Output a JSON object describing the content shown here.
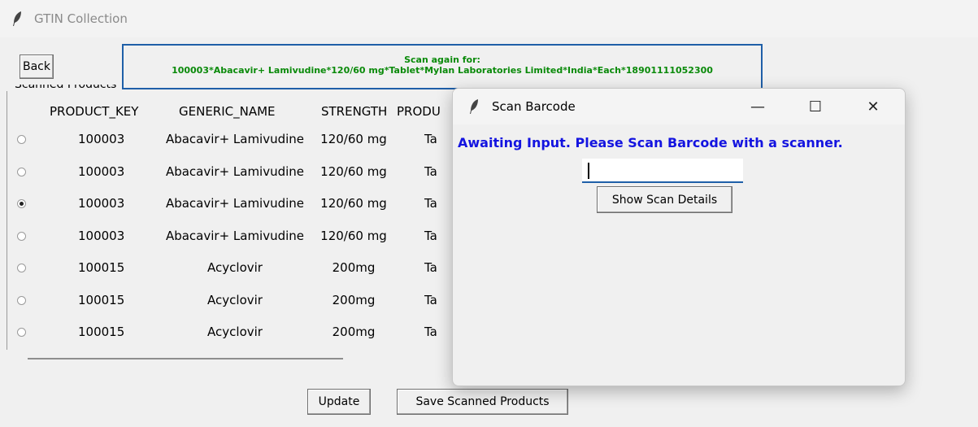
{
  "main_window": {
    "title": "GTIN Collection",
    "back_label": "Back",
    "frame_label": "Scanned Products",
    "scan_again": {
      "title": "Scan again for:",
      "detail": "100003*Abacavir+ Lamivudine*120/60 mg*Tablet*Mylan Laboratories Limited*India*Each*18901111052300"
    },
    "table": {
      "headers": [
        "PRODUCT_KEY",
        "GENERIC_NAME",
        "STRENGTH",
        "PRODU"
      ],
      "rows": [
        {
          "key": "100003",
          "name": "Abacavir+ Lamivudine",
          "strength": "120/60 mg",
          "type": "Ta",
          "selected": false
        },
        {
          "key": "100003",
          "name": "Abacavir+ Lamivudine",
          "strength": "120/60 mg",
          "type": "Ta",
          "selected": false
        },
        {
          "key": "100003",
          "name": "Abacavir+ Lamivudine",
          "strength": "120/60 mg",
          "type": "Ta",
          "selected": true
        },
        {
          "key": "100003",
          "name": "Abacavir+ Lamivudine",
          "strength": "120/60 mg",
          "type": "Ta",
          "selected": false
        },
        {
          "key": "100015",
          "name": "Acyclovir",
          "strength": "200mg",
          "type": "Ta",
          "selected": false
        },
        {
          "key": "100015",
          "name": "Acyclovir",
          "strength": "200mg",
          "type": "Ta",
          "selected": false
        },
        {
          "key": "100015",
          "name": "Acyclovir",
          "strength": "200mg",
          "type": "Ta",
          "selected": false
        }
      ]
    },
    "update_label": "Update",
    "save_label": "Save Scanned Products"
  },
  "dialog": {
    "title": "Scan Barcode",
    "minimize_glyph": "—",
    "maximize_glyph": "☐",
    "close_glyph": "✕",
    "prompt": "Awaiting Input. Please Scan Barcode with a scanner.",
    "input_value": "",
    "show_details_label": "Show Scan Details"
  },
  "colors": {
    "prompt_blue": "#1414e0",
    "scan_again_green": "#0a8a0a",
    "box_border_blue": "#1f5fa8"
  },
  "icons": [
    "feather-icon"
  ]
}
